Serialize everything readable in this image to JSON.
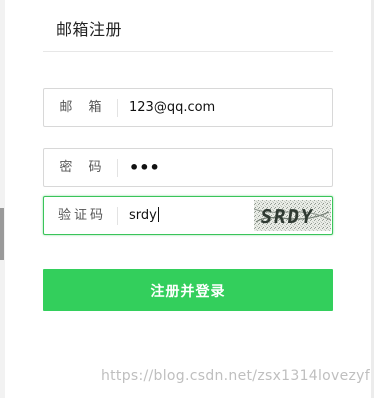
{
  "header": {
    "title": "邮箱注册"
  },
  "form": {
    "email": {
      "label": "邮 箱",
      "value": "123@qq.com"
    },
    "password": {
      "label": "密 码",
      "value": "•••"
    },
    "captcha": {
      "label": "验证码",
      "value": "srdy",
      "image_text": "SRDY"
    },
    "submit_label": "注册并登录"
  },
  "watermark": "https://blog.csdn.net/zsx1314lovezyf",
  "colors": {
    "accent": "#33cf5c",
    "focus_border": "#3ac45a",
    "field_border": "#d8d8d8"
  }
}
